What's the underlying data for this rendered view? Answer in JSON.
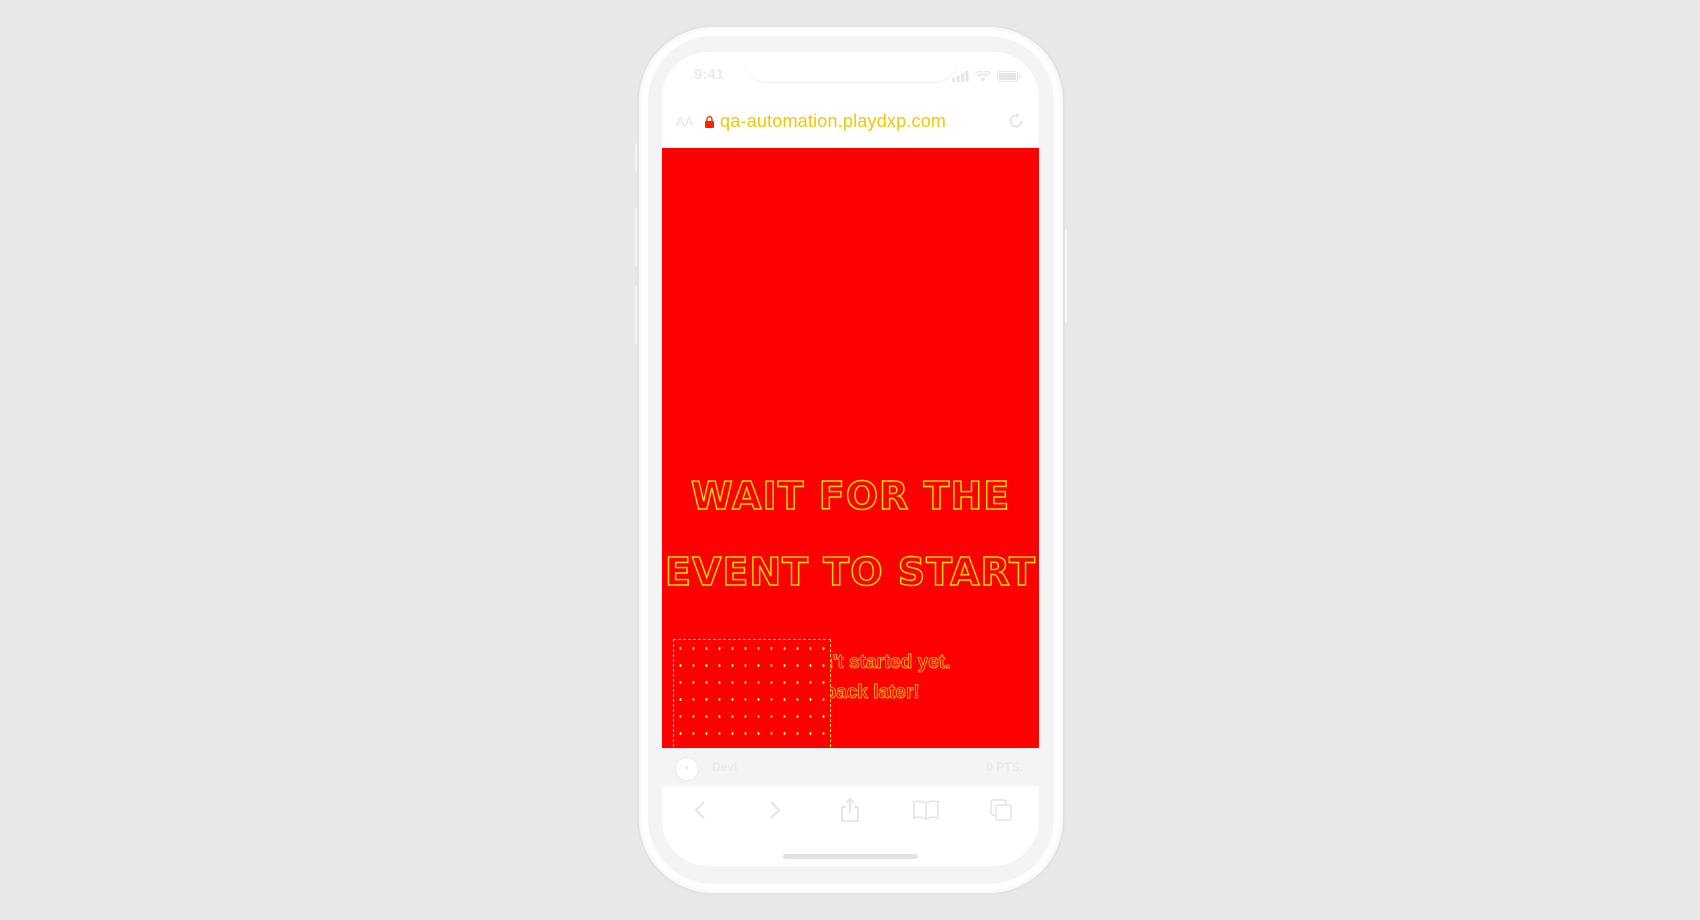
{
  "status_bar": {
    "time": "9:41"
  },
  "url_bar": {
    "text_size_label": "AA",
    "url": "qa-automation.playdxp.com"
  },
  "page": {
    "title_line1": "WAIT FOR THE",
    "title_line2": "EVENT TO START",
    "subtitle": "Event hasn't started yet. Check back later!"
  },
  "fab": {
    "label": "+"
  },
  "score_bar": {
    "avatar_label": "•",
    "player_name": "Devi",
    "points": "0 PTS."
  },
  "colors": {
    "page_background": "#ff0000",
    "outline": "#f0e000",
    "url": "#f0c800"
  },
  "icons": {
    "lock": "lock-icon",
    "reload": "reload-icon",
    "signal": "signal-icon",
    "wifi": "wifi-icon",
    "battery": "battery-icon",
    "back": "chevron-left-icon",
    "forward": "chevron-right-icon",
    "share": "share-icon",
    "bookmarks": "book-icon",
    "tabs": "tabs-icon"
  }
}
